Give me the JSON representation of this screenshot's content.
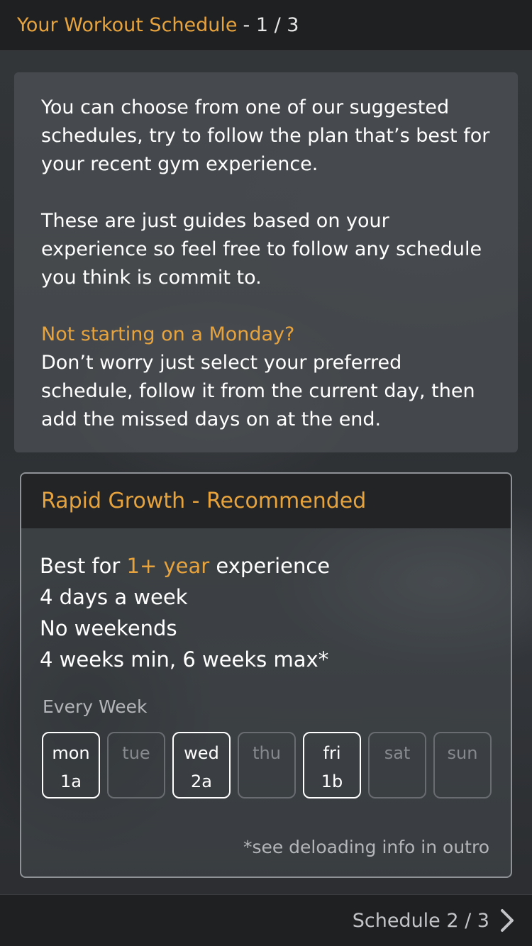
{
  "header": {
    "title": "Your Workout Schedule",
    "page": "- 1 / 3"
  },
  "intro": {
    "p1": "You can choose from one of our suggested schedules, try to follow the plan that’s best for your recent gym experience.",
    "p2": "These are just guides based on your experience so feel free to follow any schedule you think is commit to.",
    "highlight": "Not starting on a Monday?",
    "p3": "Don’t worry just select your preferred schedule, follow it from the current day, then add the missed days on at the end."
  },
  "card": {
    "title": "Rapid Growth - Recommended",
    "f1_pre": "Best for ",
    "f1_hl": "1+ year",
    "f1_post": " experience",
    "f2": "4 days a week",
    "f3": "No weekends",
    "f4": "4 weeks min, 6 weeks max*",
    "every": "Every Week",
    "days": [
      {
        "day": "mon",
        "code": "1a"
      },
      {
        "day": "tue",
        "code": ""
      },
      {
        "day": "wed",
        "code": "2a"
      },
      {
        "day": "thu",
        "code": ""
      },
      {
        "day": "fri",
        "code": "1b"
      },
      {
        "day": "sat",
        "code": ""
      },
      {
        "day": "sun",
        "code": ""
      }
    ],
    "note": "*see deloading info in outro"
  },
  "footer": {
    "next_label": "Schedule 2 / 3"
  },
  "colors": {
    "accent": "#e7a33d",
    "bar": "#1f2022"
  }
}
